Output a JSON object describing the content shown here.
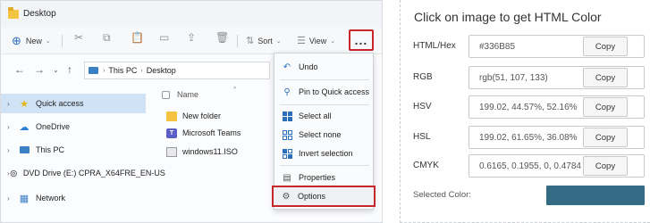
{
  "explorer": {
    "title": "Desktop",
    "toolbar": {
      "new_label": "New",
      "sort_label": "Sort",
      "view_label": "View",
      "more_label": "..."
    },
    "address": {
      "crumbs": [
        "This PC",
        "Desktop"
      ]
    },
    "sidebar": {
      "items": [
        {
          "label": "Quick access",
          "icon": "star-icon",
          "selected": true
        },
        {
          "label": "OneDrive",
          "icon": "cloud-icon"
        },
        {
          "label": "This PC",
          "icon": "computer-icon"
        },
        {
          "label": "DVD Drive (E:) CPRA_X64FRE_EN-US",
          "icon": "dvd-icon"
        },
        {
          "label": "Network",
          "icon": "network-icon"
        }
      ]
    },
    "files": {
      "column_name": "Name",
      "items": [
        {
          "name": "New folder",
          "icon": "folder-icon"
        },
        {
          "name": "Microsoft Teams",
          "icon": "teams-icon"
        },
        {
          "name": "windows11.ISO",
          "icon": "iso-icon"
        }
      ]
    },
    "menu": {
      "items": [
        {
          "label": "Undo",
          "icon": "undo-icon"
        },
        {
          "label": "Pin to Quick access",
          "icon": "pin-icon"
        },
        {
          "label": "Select all",
          "icon": "select-all-icon"
        },
        {
          "label": "Select none",
          "icon": "select-none-icon"
        },
        {
          "label": "Invert selection",
          "icon": "invert-selection-icon"
        },
        {
          "label": "Properties",
          "icon": "properties-icon"
        },
        {
          "label": "Options",
          "icon": "options-icon",
          "highlighted": true
        }
      ]
    },
    "highlight_color": "#c8262d"
  },
  "color_panel": {
    "title": "Click on image to get HTML Color",
    "copy_label": "Copy",
    "rows": [
      {
        "label": "HTML/Hex",
        "value": "#336B85"
      },
      {
        "label": "RGB",
        "value": "rgb(51, 107, 133)"
      },
      {
        "label": "HSV",
        "value": "199.02, 44.57%, 52.16%"
      },
      {
        "label": "HSL",
        "value": "199.02, 61.65%, 36.08%"
      },
      {
        "label": "CMYK",
        "value": "0.6165, 0.1955, 0, 0.4784"
      }
    ],
    "selected_label": "Selected Color:",
    "selected_color": "#336B85"
  }
}
